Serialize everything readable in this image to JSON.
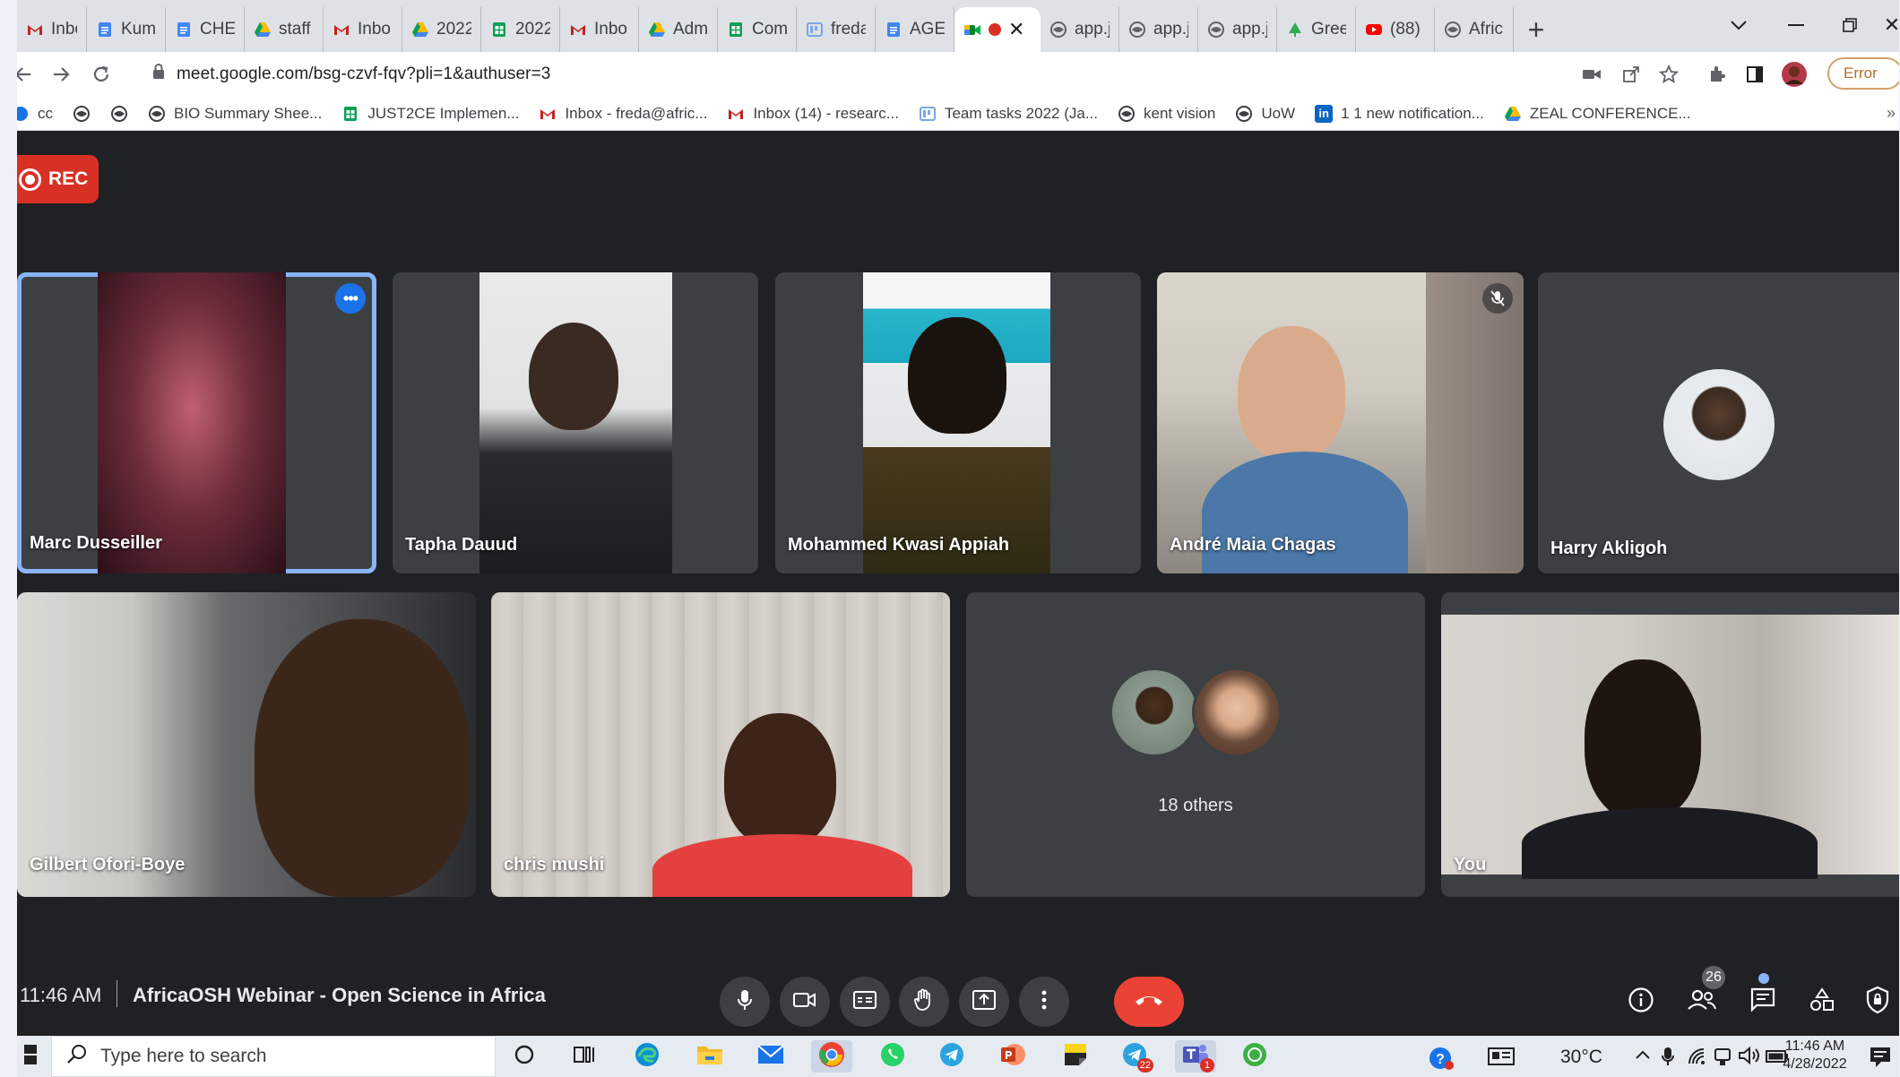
{
  "browser": {
    "tabs": [
      {
        "icon": "gmail-icon",
        "label": "Inbo",
        "color": "#c5221f"
      },
      {
        "icon": "docs-icon",
        "label": "Kum",
        "color": "#4285f4"
      },
      {
        "icon": "docs-icon",
        "label": "CHE",
        "color": "#4285f4"
      },
      {
        "icon": "drive-icon",
        "label": "staff",
        "color": "#1fa463"
      },
      {
        "icon": "gmail-icon",
        "label": "Inbo",
        "color": "#c5221f"
      },
      {
        "icon": "drive-icon",
        "label": "2022",
        "color": "#1fa463"
      },
      {
        "icon": "sheets-icon",
        "label": "2022",
        "color": "#0f9d58"
      },
      {
        "icon": "gmail-icon",
        "label": "Inbo",
        "color": "#c5221f"
      },
      {
        "icon": "drive-icon",
        "label": "Adm",
        "color": "#1fa463"
      },
      {
        "icon": "sheets-icon",
        "label": "Com",
        "color": "#0f9d58"
      },
      {
        "icon": "slides-board-icon",
        "label": "freda",
        "color": "#7aa7e8"
      },
      {
        "icon": "docs-icon",
        "label": "AGEI",
        "color": "#4285f4"
      },
      {
        "icon": "meet-icon",
        "label": "",
        "color": "#00832d",
        "active": true
      },
      {
        "icon": "globe-icon",
        "label": "app.j",
        "color": "#5f6368"
      },
      {
        "icon": "globe-icon",
        "label": "app.j",
        "color": "#5f6368"
      },
      {
        "icon": "globe-icon",
        "label": "app.j",
        "color": "#5f6368"
      },
      {
        "icon": "tree-icon",
        "label": "Gree",
        "color": "#34a853"
      },
      {
        "icon": "youtube-icon",
        "label": "(88)",
        "color": "#ff0000"
      },
      {
        "icon": "globe-icon",
        "label": "Afric",
        "color": "#5f6368"
      }
    ],
    "url": "meet.google.com/bsg-czvf-fqv?pli=1&authuser=3",
    "error_label": "Error",
    "bookmarks": [
      {
        "icon": "globe-icon",
        "label": "cc"
      },
      {
        "icon": "globe-icon",
        "label": ""
      },
      {
        "icon": "globe-icon",
        "label": ""
      },
      {
        "icon": "globe-icon",
        "label": "BIO Summary Shee..."
      },
      {
        "icon": "sheets-icon",
        "label": "JUST2CE Implemen..."
      },
      {
        "icon": "gmail-icon",
        "label": "Inbox - freda@afric..."
      },
      {
        "icon": "gmail-icon",
        "label": "Inbox (14) - researc..."
      },
      {
        "icon": "board-icon",
        "label": "Team tasks 2022 (Ja..."
      },
      {
        "icon": "globe-icon",
        "label": "kent vision"
      },
      {
        "icon": "globe-icon",
        "label": "UoW"
      },
      {
        "icon": "linkedin-icon",
        "label": "1 1 new notification..."
      },
      {
        "icon": "drive-icon",
        "label": "ZEAL CONFERENCE..."
      }
    ]
  },
  "meet": {
    "rec_label": "REC",
    "participants": [
      {
        "name": "Marc Dusseiller",
        "speaking": true
      },
      {
        "name": "Tapha Dauud"
      },
      {
        "name": "Mohammed Kwasi Appiah"
      },
      {
        "name": "André Maia Chagas",
        "muted": true
      },
      {
        "name": "Harry Akligoh"
      },
      {
        "name": "Gilbert Ofori-Boye"
      },
      {
        "name": "chris mushi"
      },
      {
        "name": "You"
      }
    ],
    "others_label": "18 others",
    "time": "11:46 AM",
    "meeting_title": "AfricaOSH Webinar - Open Science in Africa",
    "people_count": "26",
    "colors": {
      "hangup": "#ea4335",
      "rec": "#d93025",
      "speaking_outline": "#8ab4f8",
      "tile": "#3c4043",
      "background": "#202124"
    }
  },
  "taskbar": {
    "search_placeholder": "Type here to search",
    "temperature": "30°C",
    "time": "11:46 AM",
    "date": "4/28/2022",
    "badges": {
      "telegram": "22",
      "teams": "1"
    }
  }
}
